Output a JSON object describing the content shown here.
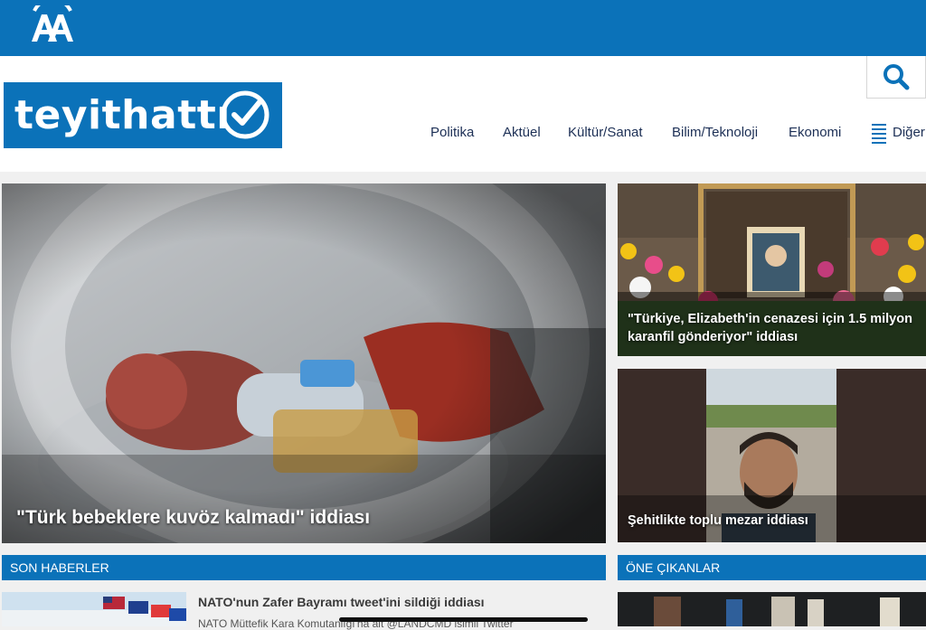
{
  "header": {
    "agency_logo": "AA",
    "brand_name": "teyithattı",
    "search_icon": "search-icon"
  },
  "nav": {
    "items": [
      "Politika",
      "Aktüel",
      "Kültür/Sanat",
      "Bilim/Teknoloji",
      "Ekonomi"
    ],
    "more_label": "Diğer",
    "more_icon": "menu-icon"
  },
  "featured": {
    "main": {
      "title": "\"Türk bebeklere kuvöz kalmadı\" iddiası"
    },
    "side": [
      {
        "title": "\"Türkiye, Elizabeth'in cenazesi için 1.5 milyon karanfil gönderiyor\" iddiası"
      },
      {
        "title": "Şehitlikte toplu mezar iddiası"
      }
    ]
  },
  "sections": {
    "latest": "SON HABERLER",
    "highlights": "ÖNE ÇIKANLAR"
  },
  "latest_news": [
    {
      "title": "NATO'nun Zafer Bayramı tweet'ini sildiği iddiası",
      "subtitle": "NATO Müttefik Kara Komutanlığı'na ait @LANDCMD isimli Twitter"
    }
  ],
  "colors": {
    "brand_blue": "#0b72b9",
    "nav_text": "#1c2f55"
  }
}
